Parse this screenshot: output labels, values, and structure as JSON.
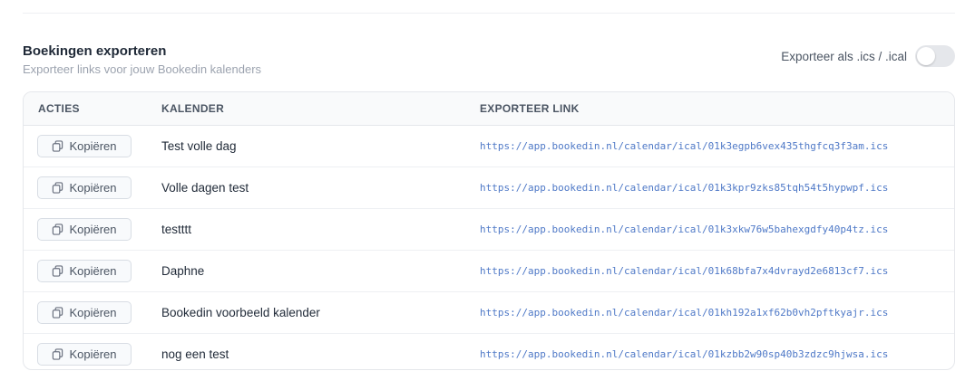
{
  "section": {
    "title": "Boekingen exporteren",
    "subtitle": "Exporteer links voor jouw Bookedin kalenders",
    "toggle_label": "Exporteer als .ics / .ical",
    "toggle_on": false
  },
  "table": {
    "headers": {
      "actions": "ACTIES",
      "calendar": "KALENDER",
      "link": "EXPORTEER LINK"
    },
    "rows": [
      {
        "button": "Kopiëren",
        "calendar": "Test volle dag",
        "link": "https://app.bookedin.nl/calendar/ical/01k3egpb6vex435thgfcq3f3am.ics"
      },
      {
        "button": "Kopiëren",
        "calendar": "Volle dagen test",
        "link": "https://app.bookedin.nl/calendar/ical/01k3kpr9zks85tqh54t5hypwpf.ics"
      },
      {
        "button": "Kopiëren",
        "calendar": "testttt",
        "link": "https://app.bookedin.nl/calendar/ical/01k3xkw76w5bahexgdfy40p4tz.ics"
      },
      {
        "button": "Kopiëren",
        "calendar": "Daphne",
        "link": "https://app.bookedin.nl/calendar/ical/01k68bfa7x4dvrayd2e6813cf7.ics"
      },
      {
        "button": "Kopiëren",
        "calendar": "Bookedin voorbeeld kalender",
        "link": "https://app.bookedin.nl/calendar/ical/01kh192a1xf62b0vh2pftkyajr.ics"
      },
      {
        "button": "Kopiëren",
        "calendar": "nog een test",
        "link": "https://app.bookedin.nl/calendar/ical/01kzbb2w90sp40b3zdzc9hjwsa.ics"
      }
    ]
  },
  "icons": {
    "copy": "copy-icon"
  },
  "colors": {
    "link": "#4f79c7",
    "toggle_off": "#e5e7eb"
  }
}
